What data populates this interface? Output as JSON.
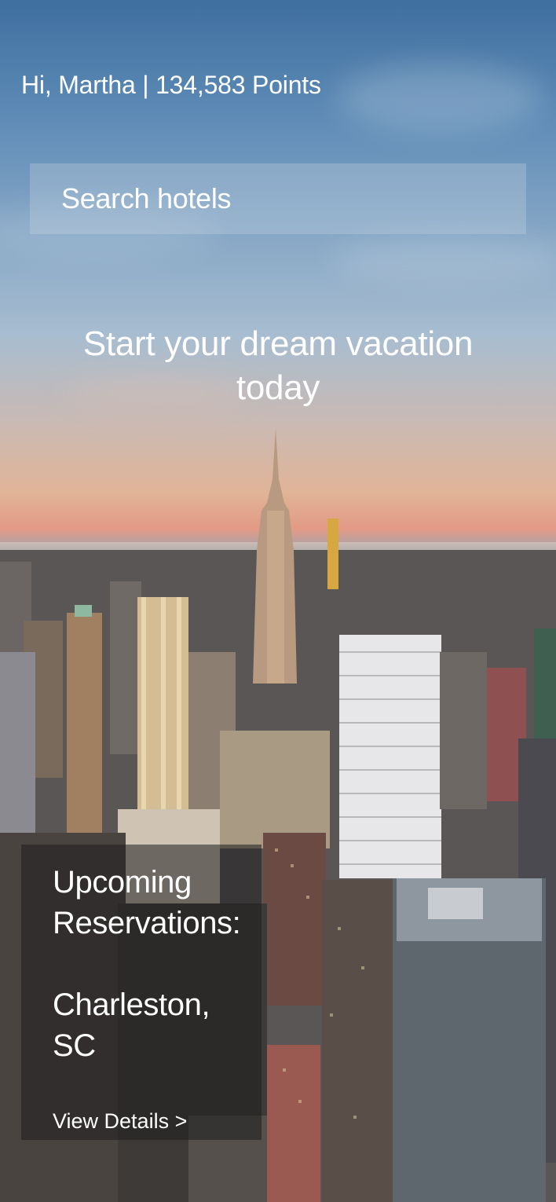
{
  "header": {
    "greeting": "Hi, Martha | 134,583 Points"
  },
  "search": {
    "placeholder": "Search hotels"
  },
  "hero": {
    "headline": "Start your dream vacation today"
  },
  "reservations": {
    "heading": "Upcoming Reservations:",
    "location": "Charleston, SC",
    "link_label": "View Details >"
  },
  "background": {
    "image": "city-skyline-at-sunset"
  }
}
